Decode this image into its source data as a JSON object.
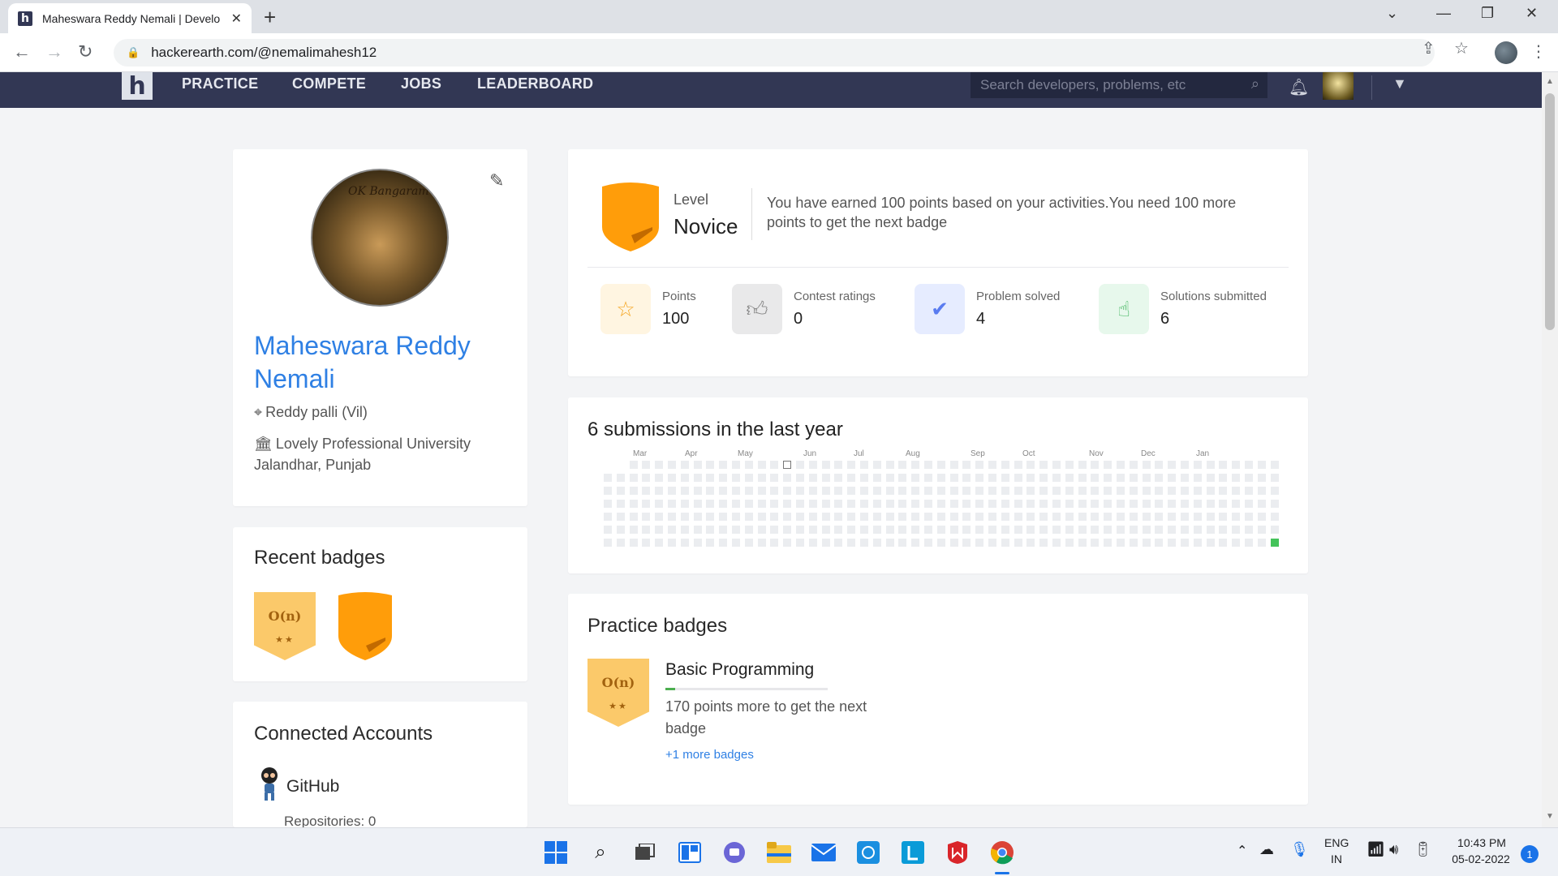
{
  "browser": {
    "tab_title": "Maheswara Reddy Nemali | Developer Profile",
    "url": "hackerearth.com/@nemalimahesh12"
  },
  "site": {
    "nav": [
      "PRACTICE",
      "COMPETE",
      "JOBS",
      "LEADERBOARD"
    ],
    "search_placeholder": "Search developers, problems, etc",
    "brand_color": "#323754",
    "accent_color": "#2f80e4"
  },
  "profile": {
    "avatar_caption": "OK Bangaram",
    "name": "Maheswara Reddy Nemali",
    "location": "Reddy palli (Vil)",
    "university": "Lovely Professional University Jalandhar, Punjab"
  },
  "recent_badges": {
    "title": "Recent badges",
    "badges": [
      {
        "kind": "hex",
        "symbol": "O(n)",
        "stars": "★★"
      },
      {
        "kind": "shield"
      }
    ]
  },
  "connected": {
    "title": "Connected Accounts",
    "github_label": "GitHub",
    "repos": "Repositories: 0"
  },
  "level": {
    "label": "Level",
    "value": "Novice",
    "message": "You have earned 100 points based on your activities.You need 100 more points to get the next badge"
  },
  "stats": [
    {
      "label": "Points",
      "value": "100",
      "icon": "star-icon",
      "bg": "#fff5e1",
      "fg": "#f5a623"
    },
    {
      "label": "Contest ratings",
      "value": "0",
      "icon": "thumbs-up-icon",
      "bg": "#e9e9ea",
      "fg": "#888888"
    },
    {
      "label": "Problem solved",
      "value": "4",
      "icon": "check-circle-icon",
      "bg": "#e6ecff",
      "fg": "#5a7cf0"
    },
    {
      "label": "Solutions submitted",
      "value": "6",
      "icon": "pointer-hand-icon",
      "bg": "#e7f8ec",
      "fg": "#3cb35a"
    }
  ],
  "submissions": {
    "title": "6 submissions in the last year",
    "months": [
      "Mar",
      "Apr",
      "May",
      "Jun",
      "Jul",
      "Aug",
      "Sep",
      "Oct",
      "Nov",
      "Dec",
      "Jan"
    ],
    "active_color": "#44c35a"
  },
  "practice": {
    "title": "Practice badges",
    "badge_name": "Basic Programming",
    "badge_symbol": "O(n)",
    "badge_stars": "★★",
    "progress_fraction": 0.06,
    "message": "170 points more to get the next badge",
    "more_link": "+1 more badges"
  },
  "taskbar": {
    "lang_top": "ENG",
    "lang_bottom": "IN",
    "time": "10:43 PM",
    "date": "05-02-2022",
    "notifications": "1"
  }
}
